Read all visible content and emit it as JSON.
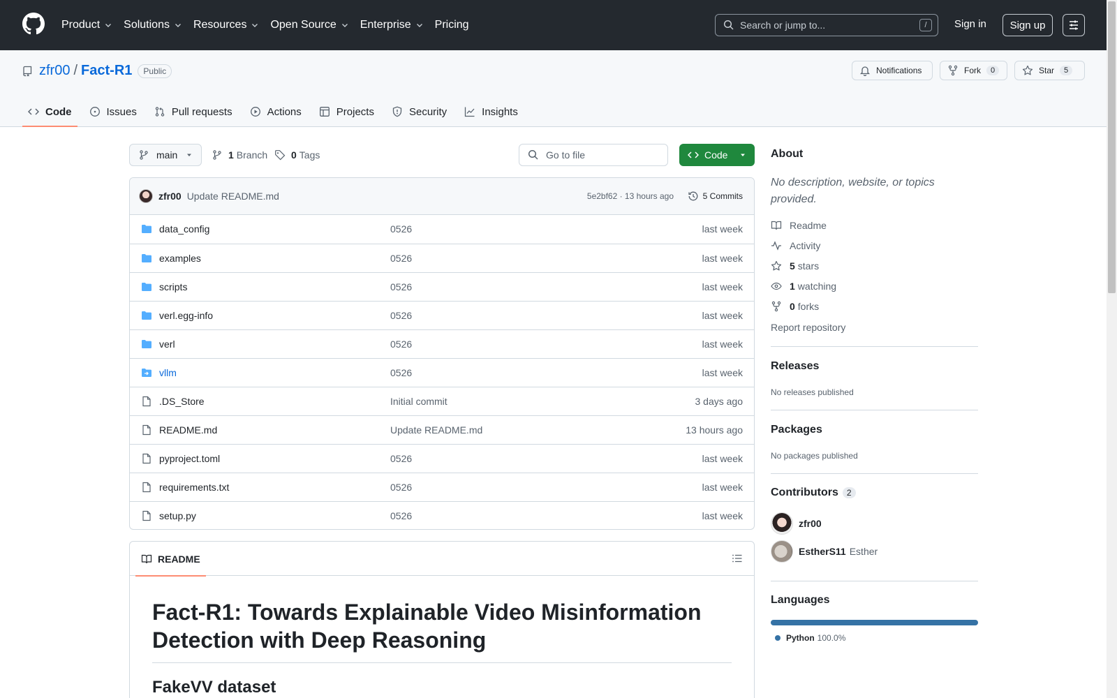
{
  "header": {
    "nav": [
      "Product",
      "Solutions",
      "Resources",
      "Open Source",
      "Enterprise",
      "Pricing"
    ],
    "search_placeholder": "Search or jump to...",
    "search_shortcut": "/",
    "signin": "Sign in",
    "signup": "Sign up"
  },
  "repo": {
    "owner": "zfr00",
    "separator": "/",
    "name": "Fact-R1",
    "visibility": "Public",
    "notifications": "Notifications",
    "fork_label": "Fork",
    "fork_count": "0",
    "star_label": "Star",
    "star_count": "5",
    "tabs": [
      "Code",
      "Issues",
      "Pull requests",
      "Actions",
      "Projects",
      "Security",
      "Insights"
    ]
  },
  "toolbar": {
    "branch": "main",
    "branch_count": "1",
    "branch_label": "Branch",
    "tag_count": "0",
    "tag_label": "Tags",
    "goto_placeholder": "Go to file",
    "code_button": "Code"
  },
  "commit": {
    "author": "zfr00",
    "message": "Update README.md",
    "meta": "5e2bf62 · 13 hours ago",
    "commits_label": "5 Commits"
  },
  "files": [
    {
      "name": "data_config",
      "type": "dir",
      "message": "0526",
      "age": "last week"
    },
    {
      "name": "examples",
      "type": "dir",
      "message": "0526",
      "age": "last week"
    },
    {
      "name": "scripts",
      "type": "dir",
      "message": "0526",
      "age": "last week"
    },
    {
      "name": "verl.egg-info",
      "type": "dir",
      "message": "0526",
      "age": "last week"
    },
    {
      "name": "verl",
      "type": "dir",
      "message": "0526",
      "age": "last week"
    },
    {
      "name": "vllm",
      "type": "submodule",
      "message": "0526",
      "age": "last week"
    },
    {
      "name": ".DS_Store",
      "type": "file",
      "message": "Initial commit",
      "age": "3 days ago"
    },
    {
      "name": "README.md",
      "type": "file",
      "message": "Update README.md",
      "age": "13 hours ago"
    },
    {
      "name": "pyproject.toml",
      "type": "file",
      "message": "0526",
      "age": "last week"
    },
    {
      "name": "requirements.txt",
      "type": "file",
      "message": "0526",
      "age": "last week"
    },
    {
      "name": "setup.py",
      "type": "file",
      "message": "0526",
      "age": "last week"
    }
  ],
  "readme": {
    "tab": "README",
    "h1": "Fact-R1: Towards Explainable Video Misinformation Detection with Deep Reasoning",
    "h2": "FakeVV dataset"
  },
  "sidebar": {
    "about_title": "About",
    "about_desc": "No description, website, or topics provided.",
    "readme": "Readme",
    "activity": "Activity",
    "stars_count": "5",
    "stars_label": "stars",
    "watching_count": "1",
    "watching_label": "watching",
    "forks_count": "0",
    "forks_label": "forks",
    "report": "Report repository",
    "releases_title": "Releases",
    "releases_none": "No releases published",
    "packages_title": "Packages",
    "packages_none": "No packages published",
    "contributors_title": "Contributors",
    "contributors_count": "2",
    "contributors": [
      {
        "login": "zfr00",
        "alias": ""
      },
      {
        "login": "EstherS11",
        "alias": "Esther"
      }
    ],
    "languages_title": "Languages",
    "languages": [
      {
        "name": "Python",
        "percent": "100.0%",
        "color": "#3572A5"
      }
    ]
  },
  "colors": {
    "header_bg": "#24292f",
    "link": "#0969da",
    "primary_button": "#1f883d",
    "tab_underline": "#fd8c73",
    "folder": "#54aeff"
  }
}
